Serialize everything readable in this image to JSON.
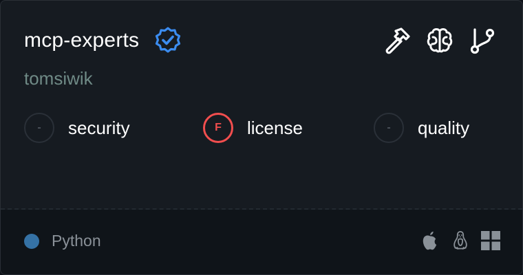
{
  "card": {
    "name": "mcp-experts",
    "owner": "tomsiwik",
    "verified_icon": "verified-badge-icon",
    "capabilities": [
      "hammer-icon",
      "brain-icon",
      "git-branch-icon"
    ]
  },
  "scores": [
    {
      "label": "security",
      "grade": "-",
      "status": "none"
    },
    {
      "label": "license",
      "grade": "F",
      "status": "fail"
    },
    {
      "label": "quality",
      "grade": "-",
      "status": "none"
    }
  ],
  "footer": {
    "language": "Python",
    "language_color": "#3572a5",
    "platforms": [
      "apple-icon",
      "linux-icon",
      "windows-icon"
    ]
  },
  "colors": {
    "background": "#161b21",
    "accent_verified": "#3b8cf0",
    "fail": "#f24e4e"
  }
}
